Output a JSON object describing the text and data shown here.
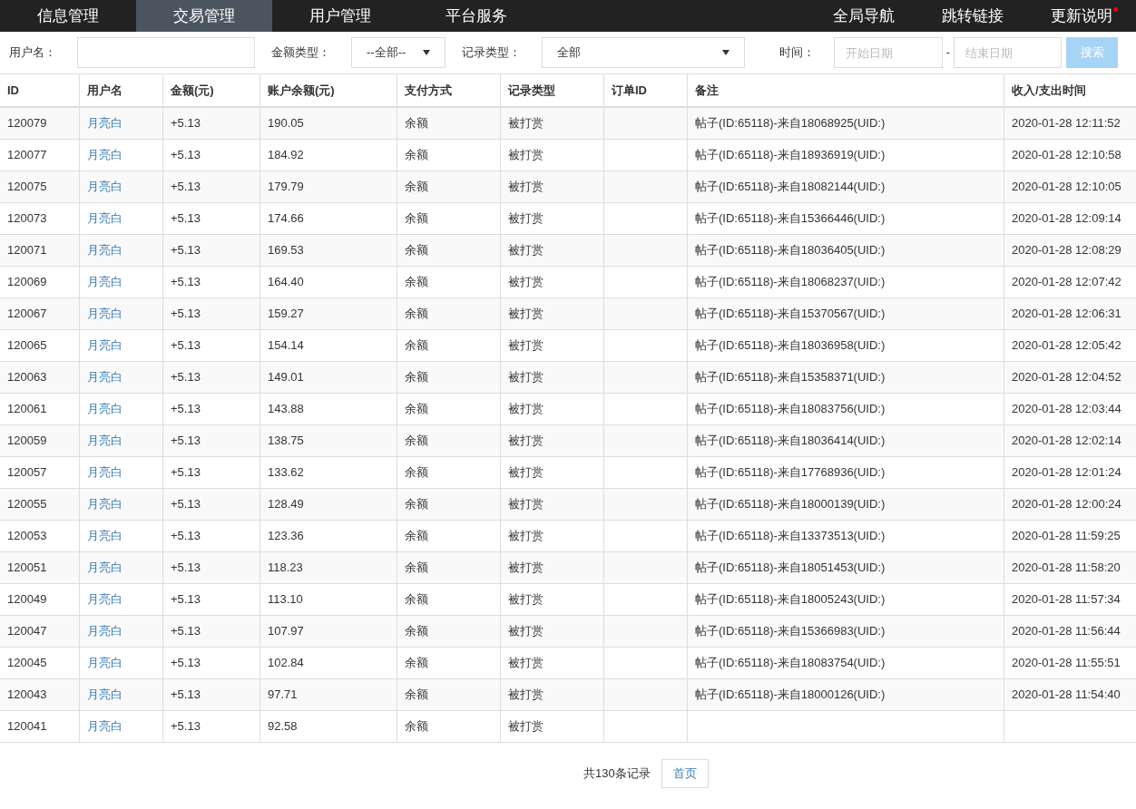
{
  "nav": {
    "left": [
      {
        "label": "信息管理",
        "selected": false
      },
      {
        "label": "交易管理",
        "selected": true
      },
      {
        "label": "用户管理",
        "selected": false
      },
      {
        "label": "平台服务",
        "selected": false
      }
    ],
    "right": [
      {
        "label": "全局导航",
        "badge": false
      },
      {
        "label": "跳转链接",
        "badge": false
      },
      {
        "label": "更新说明",
        "badge": true
      }
    ]
  },
  "filters": {
    "username_label": "用户名：",
    "amount_type_label": "金额类型：",
    "amount_type_value": "--全部--",
    "record_type_label": "记录类型：",
    "record_type_value": "全部",
    "time_label": "时间：",
    "start_placeholder": "开始日期",
    "separator": "-",
    "end_placeholder": "结束日期",
    "search_button": "搜索"
  },
  "table": {
    "columns": [
      "ID",
      "用户名",
      "金额(元)",
      "账户余额(元)",
      "支付方式",
      "记录类型",
      "订单ID",
      "备注",
      "收入/支出时间"
    ],
    "rows": [
      [
        "120079",
        "月亮白",
        "+5.13",
        "190.05",
        "余额",
        "被打赏",
        "",
        "帖子(ID:65118)-来自18068925(UID:)",
        "2020-01-28 12:11:52"
      ],
      [
        "120077",
        "月亮白",
        "+5.13",
        "184.92",
        "余额",
        "被打赏",
        "",
        "帖子(ID:65118)-来自18936919(UID:)",
        "2020-01-28 12:10:58"
      ],
      [
        "120075",
        "月亮白",
        "+5.13",
        "179.79",
        "余额",
        "被打赏",
        "",
        "帖子(ID:65118)-来自18082144(UID:)",
        "2020-01-28 12:10:05"
      ],
      [
        "120073",
        "月亮白",
        "+5.13",
        "174.66",
        "余额",
        "被打赏",
        "",
        "帖子(ID:65118)-来自15366446(UID:)",
        "2020-01-28 12:09:14"
      ],
      [
        "120071",
        "月亮白",
        "+5.13",
        "169.53",
        "余额",
        "被打赏",
        "",
        "帖子(ID:65118)-来自18036405(UID:)",
        "2020-01-28 12:08:29"
      ],
      [
        "120069",
        "月亮白",
        "+5.13",
        "164.40",
        "余额",
        "被打赏",
        "",
        "帖子(ID:65118)-来自18068237(UID:)",
        "2020-01-28 12:07:42"
      ],
      [
        "120067",
        "月亮白",
        "+5.13",
        "159.27",
        "余额",
        "被打赏",
        "",
        "帖子(ID:65118)-来自15370567(UID:)",
        "2020-01-28 12:06:31"
      ],
      [
        "120065",
        "月亮白",
        "+5.13",
        "154.14",
        "余额",
        "被打赏",
        "",
        "帖子(ID:65118)-来自18036958(UID:)",
        "2020-01-28 12:05:42"
      ],
      [
        "120063",
        "月亮白",
        "+5.13",
        "149.01",
        "余额",
        "被打赏",
        "",
        "帖子(ID:65118)-来自15358371(UID:)",
        "2020-01-28 12:04:52"
      ],
      [
        "120061",
        "月亮白",
        "+5.13",
        "143.88",
        "余额",
        "被打赏",
        "",
        "帖子(ID:65118)-来自18083756(UID:)",
        "2020-01-28 12:03:44"
      ],
      [
        "120059",
        "月亮白",
        "+5.13",
        "138.75",
        "余额",
        "被打赏",
        "",
        "帖子(ID:65118)-来自18036414(UID:)",
        "2020-01-28 12:02:14"
      ],
      [
        "120057",
        "月亮白",
        "+5.13",
        "133.62",
        "余额",
        "被打赏",
        "",
        "帖子(ID:65118)-来自17768936(UID:)",
        "2020-01-28 12:01:24"
      ],
      [
        "120055",
        "月亮白",
        "+5.13",
        "128.49",
        "余额",
        "被打赏",
        "",
        "帖子(ID:65118)-来自18000139(UID:)",
        "2020-01-28 12:00:24"
      ],
      [
        "120053",
        "月亮白",
        "+5.13",
        "123.36",
        "余额",
        "被打赏",
        "",
        "帖子(ID:65118)-来自13373513(UID:)",
        "2020-01-28 11:59:25"
      ],
      [
        "120051",
        "月亮白",
        "+5.13",
        "118.23",
        "余额",
        "被打赏",
        "",
        "帖子(ID:65118)-来自18051453(UID:)",
        "2020-01-28 11:58:20"
      ],
      [
        "120049",
        "月亮白",
        "+5.13",
        "113.10",
        "余额",
        "被打赏",
        "",
        "帖子(ID:65118)-来自18005243(UID:)",
        "2020-01-28 11:57:34"
      ],
      [
        "120047",
        "月亮白",
        "+5.13",
        "107.97",
        "余额",
        "被打赏",
        "",
        "帖子(ID:65118)-来自15366983(UID:)",
        "2020-01-28 11:56:44"
      ],
      [
        "120045",
        "月亮白",
        "+5.13",
        "102.84",
        "余额",
        "被打赏",
        "",
        "帖子(ID:65118)-来自18083754(UID:)",
        "2020-01-28 11:55:51"
      ],
      [
        "120043",
        "月亮白",
        "+5.13",
        "97.71",
        "余额",
        "被打赏",
        "",
        "帖子(ID:65118)-来自18000126(UID:)",
        "2020-01-28 11:54:40"
      ],
      [
        "120041",
        "月亮白",
        "+5.13",
        "92.58",
        "余额",
        "被打赏",
        "",
        "",
        ""
      ]
    ]
  },
  "footer": {
    "total": "共130条记录",
    "pagination": [
      "首页"
    ]
  }
}
